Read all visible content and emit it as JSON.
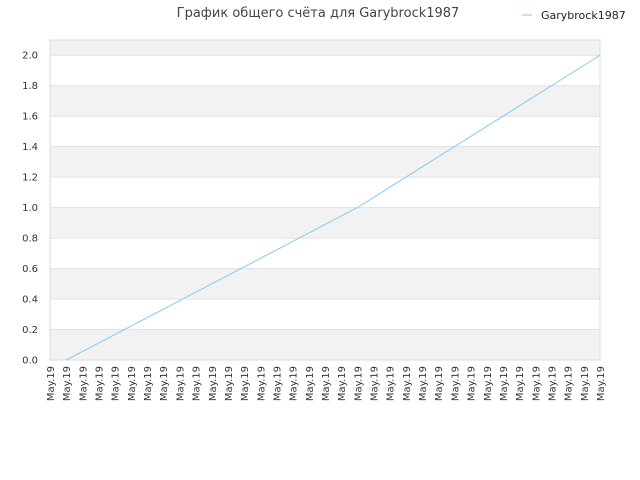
{
  "chart_data": {
    "type": "line",
    "title": "График общего счёта для Garybrock1987",
    "xlabel": "",
    "ylabel": "",
    "categories": [
      "May.19",
      "May.19",
      "May.19",
      "May.19",
      "May.19",
      "May.19",
      "May.19",
      "May.19",
      "May.19",
      "May.19",
      "May.19",
      "May.19",
      "May.19",
      "May.19",
      "May.19",
      "May.19",
      "May.19",
      "May.19",
      "May.19",
      "May.19",
      "May.19",
      "May.19",
      "May.19",
      "May.19",
      "May.19",
      "May.19",
      "May.19",
      "May.19",
      "May.19",
      "May.19",
      "May.19",
      "May.19",
      "May.19",
      "May.19",
      "May.19"
    ],
    "y_ticks": [
      "0.0",
      "0.2",
      "0.4",
      "0.6",
      "0.8",
      "1.0",
      "1.2",
      "1.4",
      "1.6",
      "1.8",
      "2.0"
    ],
    "ylim": [
      0,
      2.1
    ],
    "grid": true,
    "legend_position": "top-right",
    "series": [
      {
        "name": "Garybrock1987",
        "color": "#88c8f8",
        "points": [
          {
            "i": 1,
            "y": 0.0
          },
          {
            "i": 19,
            "y": 1.0
          },
          {
            "i": 34,
            "y": 2.0
          }
        ]
      }
    ],
    "colors": {
      "band": "#f2f2f2",
      "grid": "#e0e0e0",
      "axis": "#dddddd"
    }
  }
}
